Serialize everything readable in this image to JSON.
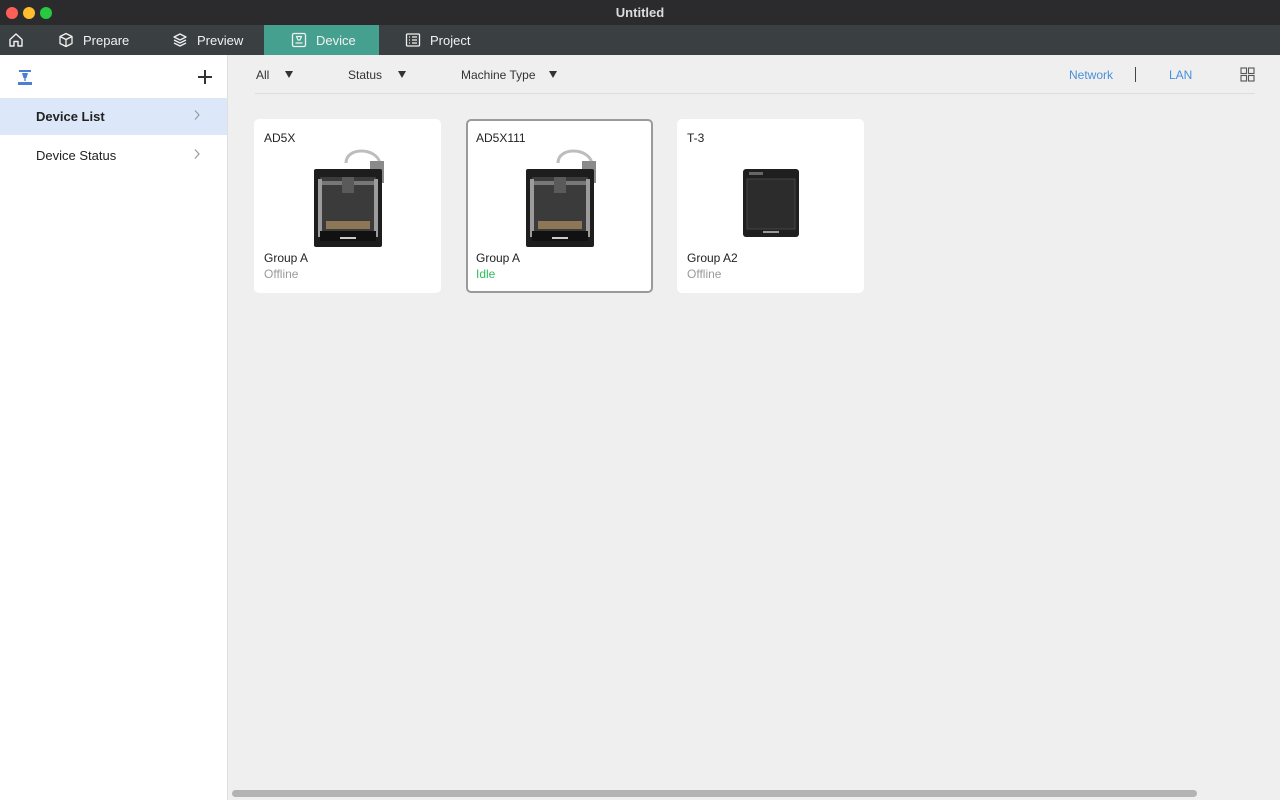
{
  "window": {
    "title": "Untitled"
  },
  "tabs": {
    "home_icon": "home-icon",
    "prepare": "Prepare",
    "preview": "Preview",
    "device": "Device",
    "project": "Project",
    "active_color": "#46a08f"
  },
  "sidebar": {
    "items": [
      {
        "label": "Device List",
        "selected": true
      },
      {
        "label": "Device Status",
        "selected": false
      }
    ]
  },
  "filters": {
    "all": "All",
    "status": "Status",
    "machine_type": "Machine Type"
  },
  "links": {
    "network": "Network",
    "lan": "LAN"
  },
  "devices": [
    {
      "name": "AD5X",
      "group": "Group A",
      "status": "Offline",
      "image": "printer-ad5x"
    },
    {
      "name": "AD5X111",
      "group": "Group A",
      "status": "Idle",
      "image": "printer-ad5x",
      "selected": true
    },
    {
      "name": "T-3",
      "group": "Group A2",
      "status": "Offline",
      "image": "printer-enclosed"
    }
  ],
  "colors": {
    "status_offline": "#9a9a9a",
    "status_idle": "#2ebd5c",
    "link": "#4a8fd9",
    "selected_item_bg": "#dce8f9"
  }
}
